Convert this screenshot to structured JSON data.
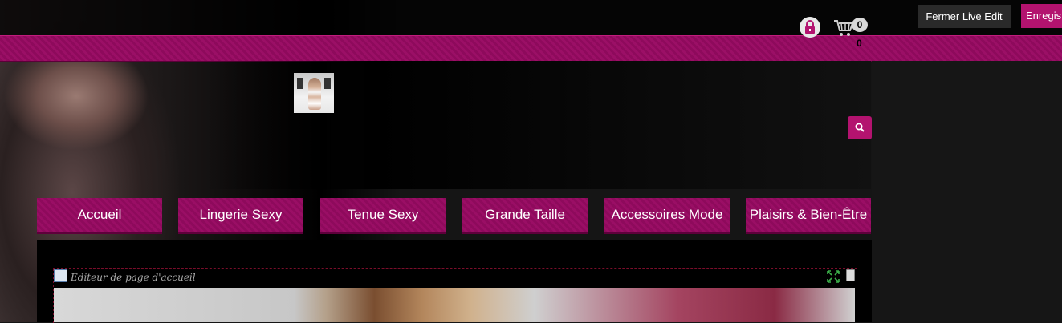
{
  "toolbar": {
    "close_live_edit_label": "Fermer Live Edit",
    "save_label": "Enregistrer"
  },
  "header": {
    "cart_count_badge": "0",
    "cart_count_text": "0"
  },
  "nav": {
    "items": [
      {
        "label": "Accueil"
      },
      {
        "label": "Lingerie Sexy"
      },
      {
        "label": "Tenue Sexy"
      },
      {
        "label": "Grande Taille"
      },
      {
        "label": "Accessoires Mode"
      },
      {
        "label": "Plaisirs & Bien-Être"
      }
    ]
  },
  "editor": {
    "title": "Editeur de page d'accueil"
  },
  "colors": {
    "accent": "#b3136f",
    "band": "#8e0a5c",
    "background": "#151515"
  },
  "icons": [
    "lock-icon",
    "cart-icon",
    "search-icon",
    "page-icon",
    "expand-icon",
    "trash-icon"
  ]
}
